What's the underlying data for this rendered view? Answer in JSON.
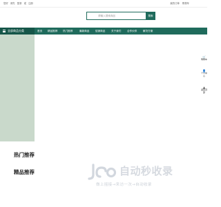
{
  "topbar": {
    "left_items": [
      "您好",
      "请先",
      "登录",
      "或",
      "注册"
    ],
    "right_items": [
      "我的订单",
      "购物车"
    ]
  },
  "search": {
    "placeholder": "请输入搜索商品",
    "button_label": "搜索"
  },
  "nav": {
    "all_categories_label": "全部商品分类",
    "items": [
      "首页",
      "精品推荐",
      "热门推荐",
      "最新商品",
      "促销商品",
      "关于我们",
      "合作伙伴",
      "解决方案"
    ]
  },
  "floating_sidebar": {
    "items": [
      {
        "icon": "cart-icon",
        "label": "购物车"
      },
      {
        "icon": "user-icon",
        "label": "个人中心"
      },
      {
        "icon": "top-icon",
        "label": "返回顶部"
      }
    ]
  },
  "sections": {
    "hot_title": "热门推荐",
    "featured_title": "精品推荐"
  },
  "watermark": {
    "title": "自动秒收录",
    "tagline": "做上摇接→来访一次→自动收录"
  },
  "colors": {
    "primary": "#1f6b5c",
    "primary_dark": "#165649",
    "banner_bg": "#c9d9cb"
  }
}
